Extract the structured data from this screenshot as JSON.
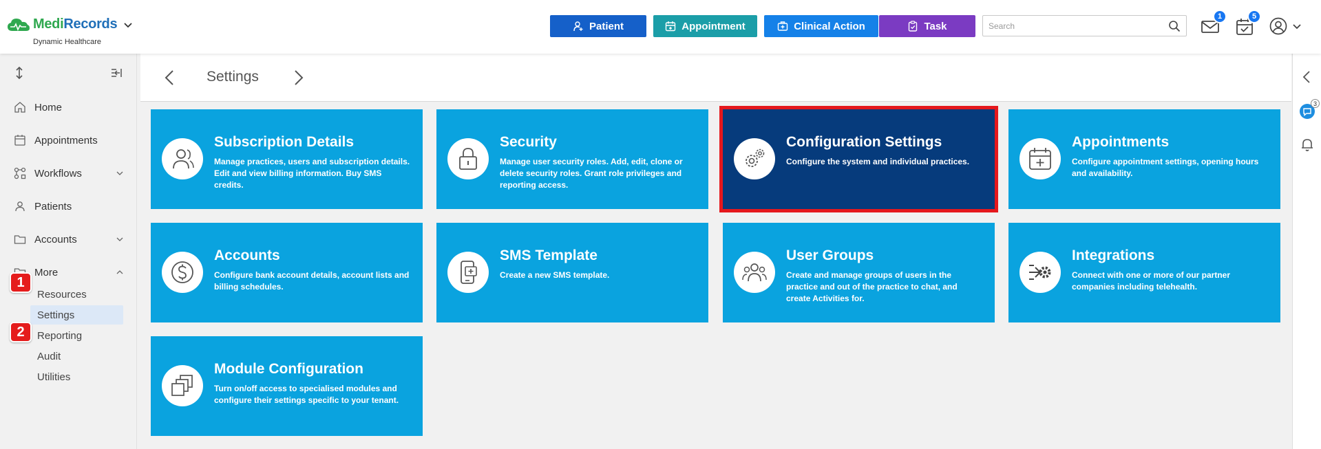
{
  "app": {
    "brand_part1": "Medi",
    "brand_part2": "Records",
    "org_name": "Dynamic Healthcare"
  },
  "header": {
    "buttons": [
      {
        "label": "Patient",
        "icon": "add-user-icon",
        "color": "#1560c9"
      },
      {
        "label": "Appointment",
        "icon": "calendar-icon",
        "color": "#1b9ea8"
      },
      {
        "label": "Clinical Action",
        "icon": "medical-kit-icon",
        "color": "#1581e8"
      },
      {
        "label": "Task",
        "icon": "clipboard-icon",
        "color": "#7b3bc2"
      }
    ],
    "search_placeholder": "Search",
    "mail_badge": "1",
    "tasks_badge": "5"
  },
  "sidebar": {
    "items": [
      {
        "label": "Home",
        "icon": "home-icon"
      },
      {
        "label": "Appointments",
        "icon": "calendar-icon"
      },
      {
        "label": "Workflows",
        "icon": "workflow-icon"
      },
      {
        "label": "Patients",
        "icon": "patients-icon"
      },
      {
        "label": "Accounts",
        "icon": "folder-icon"
      },
      {
        "label": "More",
        "icon": "folder-icon"
      }
    ],
    "more_sub": [
      {
        "label": "Resources"
      },
      {
        "label": "Settings",
        "active": true
      },
      {
        "label": "Reporting"
      },
      {
        "label": "Audit"
      },
      {
        "label": "Utilities"
      }
    ],
    "steps": [
      "1",
      "2"
    ]
  },
  "main": {
    "title": "Settings",
    "cards": [
      {
        "title": "Subscription Details",
        "desc": "Manage practices, users and subscription details. Edit and view billing information. Buy SMS credits.",
        "icon": "person-icon"
      },
      {
        "title": "Security",
        "desc": "Manage user security roles. Add, edit, clone or delete security roles. Grant role privileges and reporting access.",
        "icon": "lock-icon"
      },
      {
        "title": "Configuration Settings",
        "desc": "Configure the system and individual practices.",
        "icon": "gears-icon",
        "selected": true
      },
      {
        "title": "Appointments",
        "desc": "Configure appointment settings, opening hours and availability.",
        "icon": "calendar-plus-icon"
      },
      {
        "title": "Accounts",
        "desc": "Configure bank account details, account lists and billing schedules.",
        "icon": "dollar-icon"
      },
      {
        "title": "SMS Template",
        "desc": "Create a new SMS template.",
        "icon": "phone-plus-icon"
      },
      {
        "title": "User Groups",
        "desc": "Create and manage groups of users in the practice and out of the practice to chat, and create Activities for.",
        "icon": "users-icon"
      },
      {
        "title": "Integrations",
        "desc": "Connect with one or more of our partner companies including telehealth.",
        "icon": "integration-icon"
      },
      {
        "title": "Module Configuration",
        "desc": "Turn on/off access to specialised modules and configure their settings specific to your tenant.",
        "icon": "modules-icon"
      }
    ]
  },
  "rail": {
    "chat_badge": "3"
  }
}
